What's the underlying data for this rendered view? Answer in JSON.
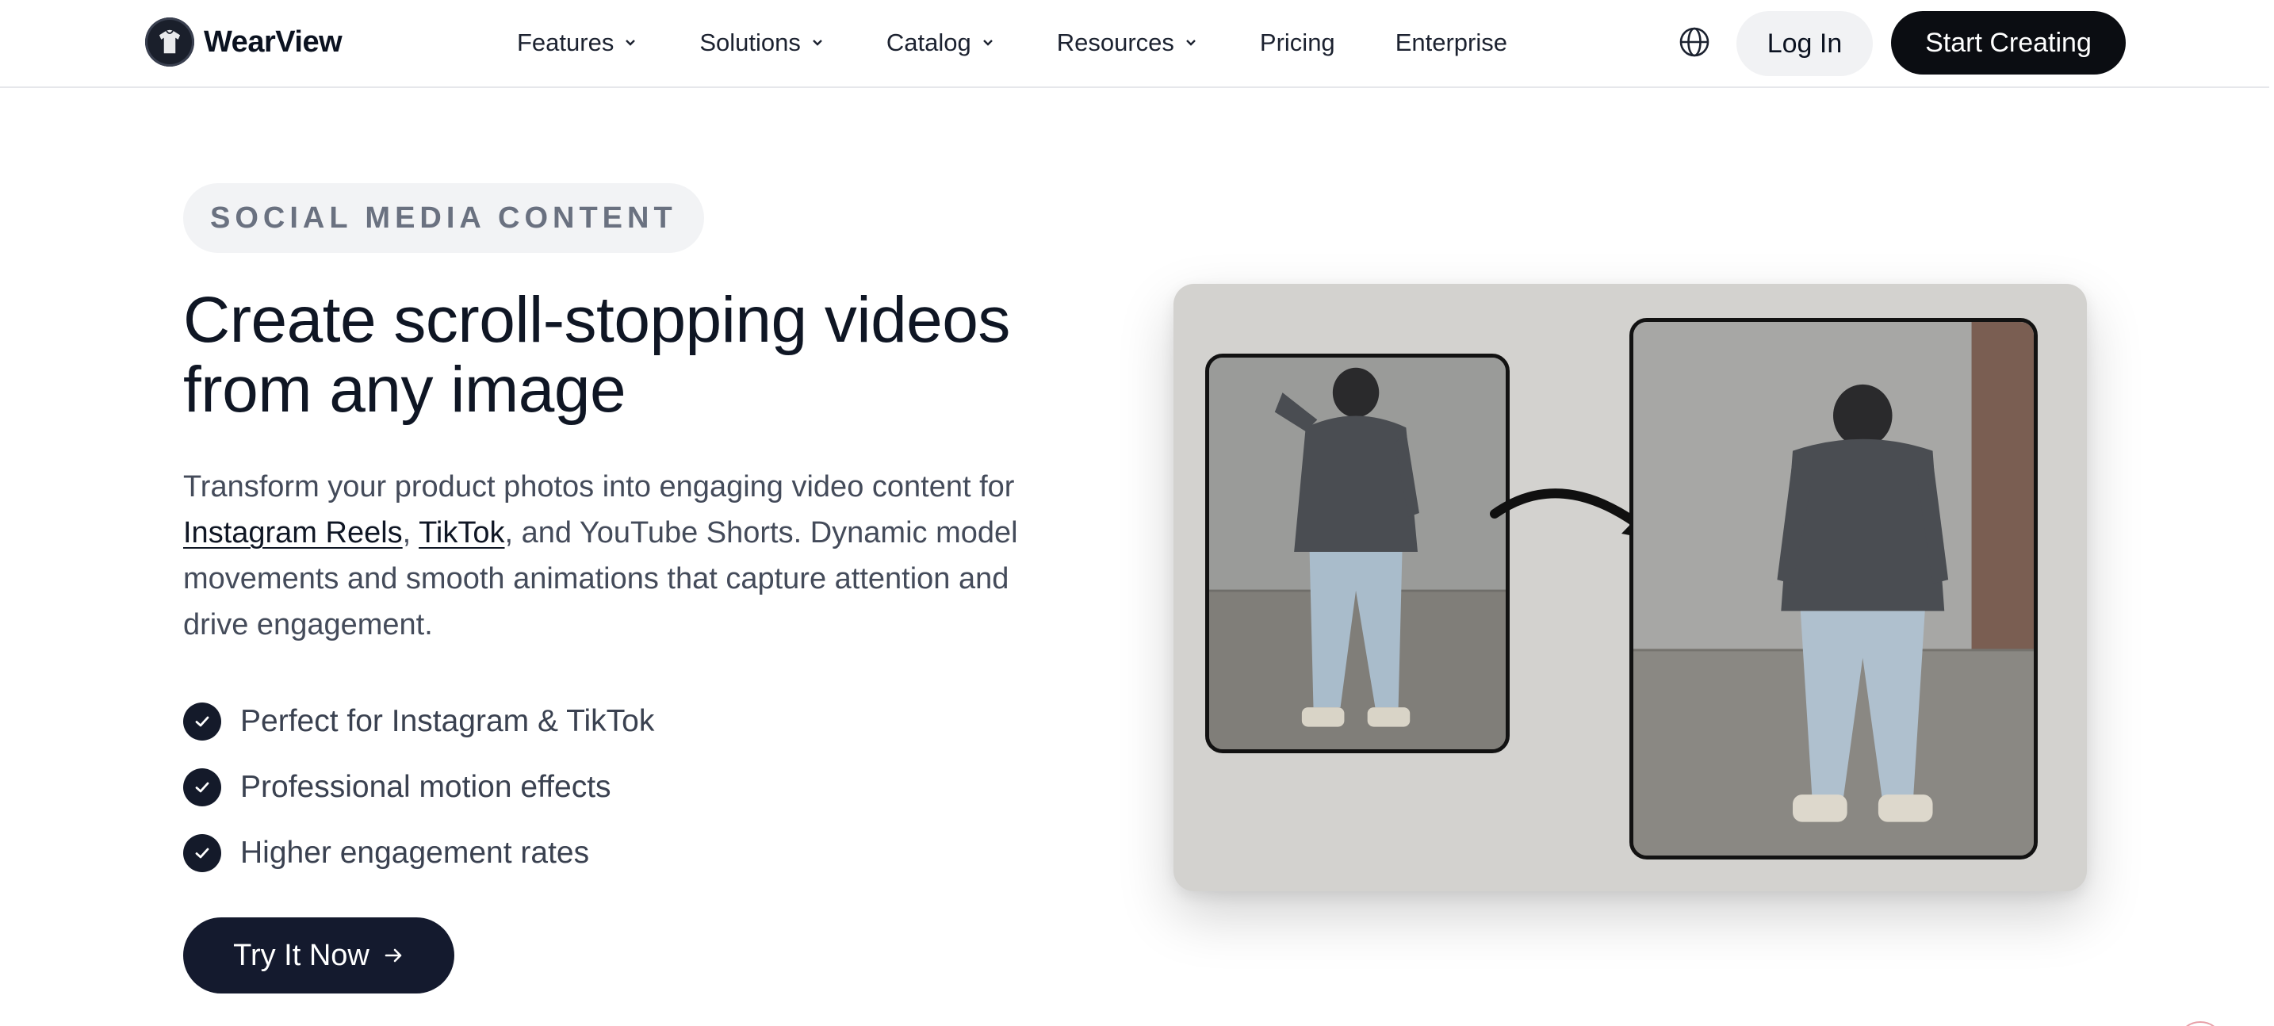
{
  "brand": {
    "name": "WearView",
    "logo_icon": "hoodie-logo-icon"
  },
  "nav": {
    "items": [
      {
        "label": "Features",
        "has_dropdown": true
      },
      {
        "label": "Solutions",
        "has_dropdown": true
      },
      {
        "label": "Catalog",
        "has_dropdown": true
      },
      {
        "label": "Resources",
        "has_dropdown": true
      },
      {
        "label": "Pricing",
        "has_dropdown": false
      },
      {
        "label": "Enterprise",
        "has_dropdown": false
      }
    ],
    "language_icon": "globe-icon",
    "login_label": "Log In",
    "cta_label": "Start Creating"
  },
  "section": {
    "eyebrow": "SOCIAL MEDIA CONTENT",
    "headline_line1": "Create scroll-stopping videos",
    "headline_line2": "from any image",
    "description": {
      "lead": "Transform your product photos into engaging video content for ",
      "link1": "Instagram Reels",
      "sep": ", ",
      "link2": "TikTok",
      "tail": ", and YouTube Shorts. Dynamic model movements and smooth animations that capture attention and drive engagement."
    },
    "features": [
      "Perfect for Instagram & TikTok",
      "Professional motion effects",
      "Higher engagement rates"
    ],
    "cta_label": "Try It Now",
    "cta_icon": "arrow-right-icon"
  },
  "visual": {
    "before_image": "model-standing-hand-on-cap-photo",
    "after_image": "model-looking-down-photo",
    "transition_icon": "curved-arrow-icon"
  },
  "colors": {
    "primary_dark": "#141a2e",
    "text_muted": "#444b5a",
    "card_bg": "#d3d2cf",
    "eyebrow_bg": "#f2f3f5"
  }
}
